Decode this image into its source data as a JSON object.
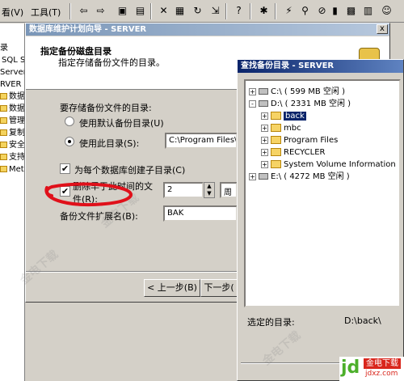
{
  "toolbar": {
    "menu_view": "看(V)",
    "menu_tools": "工具(T)"
  },
  "mmc_tree": {
    "items": [
      "录",
      "SQL S",
      "Server",
      "RVER",
      "数据",
      "数据",
      "管理",
      "复制",
      "安全",
      "支持",
      "Met"
    ]
  },
  "wizard": {
    "title": "数据库维护计划向导 - SERVER",
    "close_label": "x",
    "header_title": "指定备份磁盘目录",
    "header_subtitle": "指定存储备份文件的目录。",
    "dir_group_label": "要存储备份文件的目录:",
    "radio_default": "使用默认备份目录(U)",
    "radio_this": "使用此目录(S):",
    "dir_value": "C:\\Program Files\\Mi",
    "subdir_label": "为每个数据库创建子目录(C)",
    "delete_label_1": "删除早于此时间的文",
    "delete_label_2": "件(R):",
    "delete_value": "2",
    "delete_unit": "周",
    "ext_label": "备份文件扩展名(B):",
    "ext_value": "BAK",
    "back_button": "< 上一步(B)",
    "next_button": "下一步("
  },
  "browse": {
    "title": "查找备份目录 - SERVER",
    "tree": [
      {
        "label": "C:\\ ( 599 MB 空闲 )",
        "kind": "drive",
        "expander": "+"
      },
      {
        "label": "D:\\ ( 2331 MB 空闲 )",
        "kind": "drive",
        "expander": "-"
      },
      {
        "label": "back",
        "kind": "folder",
        "expander": "+"
      },
      {
        "label": "mbc",
        "kind": "folder",
        "expander": "+"
      },
      {
        "label": "Program Files",
        "kind": "folder",
        "expander": "+"
      },
      {
        "label": "RECYCLER",
        "kind": "folder",
        "expander": "+"
      },
      {
        "label": "System Volume Information",
        "kind": "folder",
        "expander": "+"
      },
      {
        "label": "E:\\ ( 4272 MB 空闲 )",
        "kind": "drive",
        "expander": "+"
      }
    ],
    "selected_label": "选定的目录:",
    "selected_value": "D:\\back\\"
  },
  "badge": {
    "jd": "jd",
    "site_name": "金电下载",
    "site_url": "jdxz.com"
  },
  "colors": {
    "title_active": "#0a246a",
    "title_inactive": "#7a96b8",
    "scribble": "#e0101a",
    "badge_green": "#4caf2a",
    "badge_red": "#d9261c"
  }
}
